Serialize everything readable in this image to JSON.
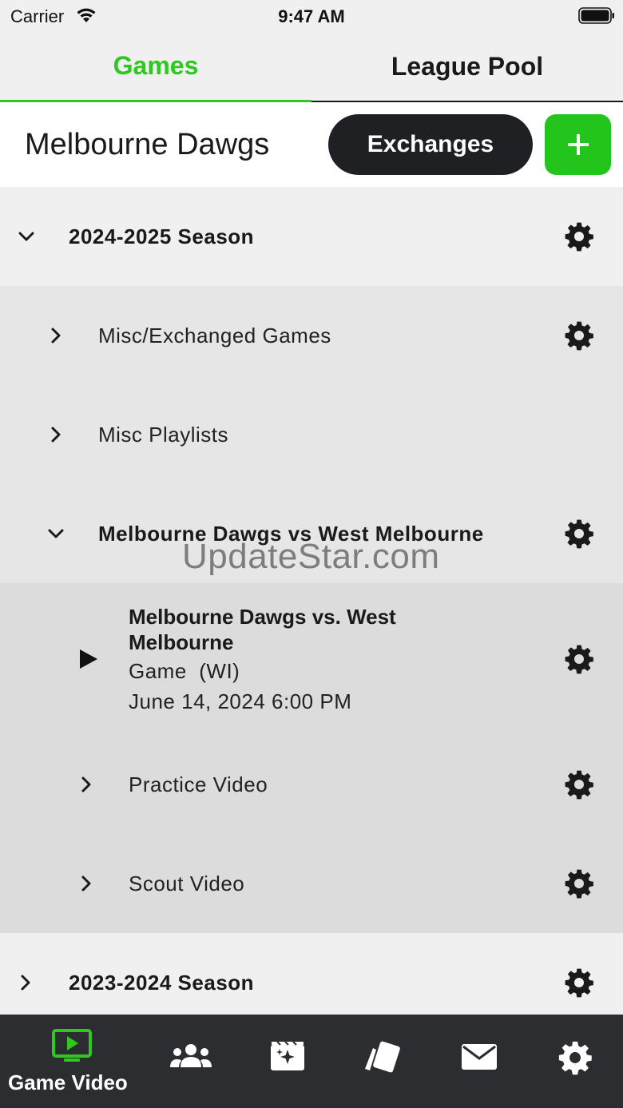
{
  "status_bar": {
    "carrier": "Carrier",
    "time": "9:47 AM"
  },
  "top_tabs": [
    {
      "label": "Games",
      "active": true
    },
    {
      "label": "League Pool",
      "active": false
    }
  ],
  "team": {
    "name": "Melbourne Dawgs",
    "exchanges_label": "Exchanges"
  },
  "tree": {
    "season_2024": {
      "label": "2024-2025 Season",
      "expanded": true
    },
    "misc_exchanged": {
      "label": "Misc/Exchanged Games",
      "expanded": false
    },
    "misc_playlists": {
      "label": "Misc Playlists",
      "expanded": false
    },
    "matchup_folder": {
      "label": "Melbourne Dawgs vs West Melbourne",
      "expanded": true
    },
    "game": {
      "title": "Melbourne Dawgs vs. West Melbourne",
      "type": "Game  (WI)",
      "date": "June 14, 2024 6:00 PM"
    },
    "practice_video": {
      "label": "Practice Video",
      "expanded": false
    },
    "scout_video": {
      "label": "Scout Video",
      "expanded": false
    },
    "season_2023": {
      "label": "2023-2024 Season",
      "expanded": false
    }
  },
  "watermark": "UpdateStar.com",
  "bottom_nav": {
    "active_label": "Game Video",
    "items": [
      {
        "icon": "game-video-icon",
        "label": "Game Video"
      },
      {
        "icon": "team-icon"
      },
      {
        "icon": "highlights-icon"
      },
      {
        "icon": "cards-icon"
      },
      {
        "icon": "mail-icon"
      },
      {
        "icon": "settings-icon"
      }
    ]
  },
  "colors": {
    "accent": "#2ec81f",
    "dark": "#1e2024",
    "nav_bg": "#2b2d31"
  }
}
